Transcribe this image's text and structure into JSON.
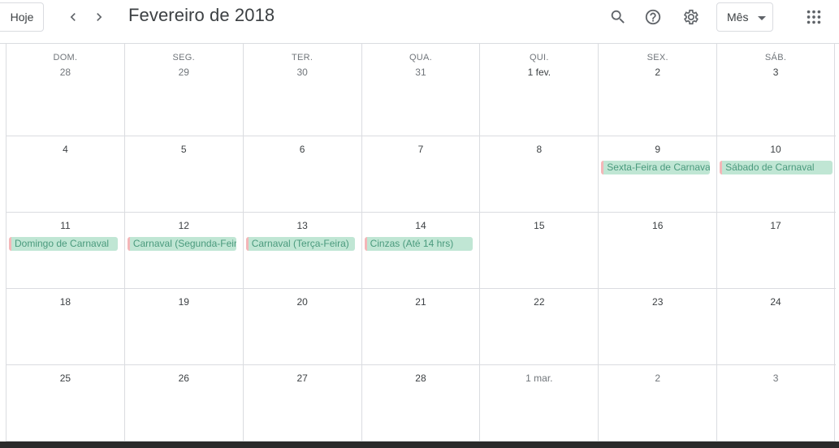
{
  "toolbar": {
    "today_label": "Hoje",
    "prev_icon": "chevron-left-icon",
    "next_icon": "chevron-right-icon",
    "title": "Fevereiro de 2018",
    "search_icon": "search-icon",
    "help_icon": "help-icon",
    "settings_icon": "gear-icon",
    "view_label": "Mês",
    "apps_icon": "apps-grid-icon"
  },
  "weekdays": [
    "DOM.",
    "SEG.",
    "TER.",
    "QUA.",
    "QUI.",
    "SEX.",
    "SÁB."
  ],
  "weeks": [
    {
      "days": [
        {
          "label": "28",
          "other": true
        },
        {
          "label": "29",
          "other": true
        },
        {
          "label": "30",
          "other": true
        },
        {
          "label": "31",
          "other": true
        },
        {
          "label": "1 fev.",
          "other": false
        },
        {
          "label": "2",
          "other": false
        },
        {
          "label": "3",
          "other": false
        }
      ]
    },
    {
      "days": [
        {
          "label": "4"
        },
        {
          "label": "5"
        },
        {
          "label": "6"
        },
        {
          "label": "7"
        },
        {
          "label": "8"
        },
        {
          "label": "9",
          "event": "Sexta-Feira de Carnaval"
        },
        {
          "label": "10",
          "event": "Sábado de Carnaval"
        }
      ]
    },
    {
      "days": [
        {
          "label": "11",
          "event": "Domingo de Carnaval"
        },
        {
          "label": "12",
          "event": "Carnaval (Segunda-Feira)"
        },
        {
          "label": "13",
          "event": "Carnaval (Terça-Feira)"
        },
        {
          "label": "14",
          "event": "Cinzas (Até 14 hrs)"
        },
        {
          "label": "15"
        },
        {
          "label": "16"
        },
        {
          "label": "17"
        }
      ]
    },
    {
      "days": [
        {
          "label": "18"
        },
        {
          "label": "19"
        },
        {
          "label": "20"
        },
        {
          "label": "21"
        },
        {
          "label": "22"
        },
        {
          "label": "23"
        },
        {
          "label": "24"
        }
      ]
    },
    {
      "days": [
        {
          "label": "25"
        },
        {
          "label": "26"
        },
        {
          "label": "27"
        },
        {
          "label": "28"
        },
        {
          "label": "1 mar.",
          "other": true
        },
        {
          "label": "2",
          "other": true
        },
        {
          "label": "3",
          "other": true
        }
      ]
    }
  ],
  "colors": {
    "event_bg": "#c0e6d4",
    "event_text": "#4a9a7d",
    "event_stripe": "#f4b6b8"
  }
}
